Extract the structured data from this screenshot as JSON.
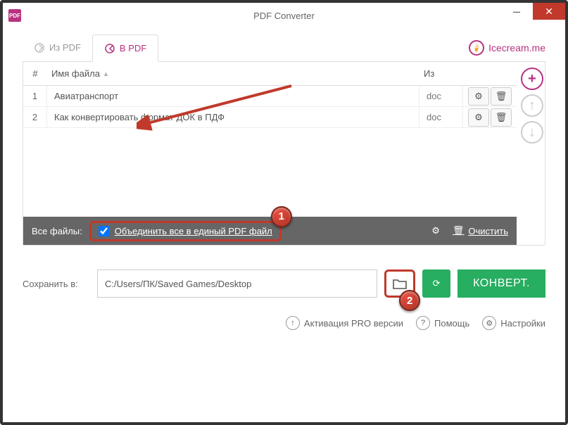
{
  "window": {
    "title": "PDF Converter"
  },
  "tabs": {
    "from_pdf": "Из PDF",
    "to_pdf": "В PDF"
  },
  "brand": "Icecream.me",
  "table": {
    "header": {
      "num": "#",
      "name": "Имя файла",
      "from": "Из"
    },
    "rows": [
      {
        "n": "1",
        "name": "Авиатранспорт",
        "from": "doc"
      },
      {
        "n": "2",
        "name": "Как конвертировать формат ДОК в ПДФ",
        "from": "doc"
      }
    ]
  },
  "allbar": {
    "label": "Все файлы:",
    "merge": "Объединить все в единый PDF файл",
    "clear": "Очистить"
  },
  "save": {
    "label": "Сохранить в:",
    "path": "C:/Users/ПК/Saved Games/Desktop"
  },
  "convert": "КОНВЕРТ.",
  "footer": {
    "pro": "Активация PRO версии",
    "help": "Помощь",
    "settings": "Настройки"
  },
  "badges": {
    "b1": "1",
    "b2": "2"
  }
}
